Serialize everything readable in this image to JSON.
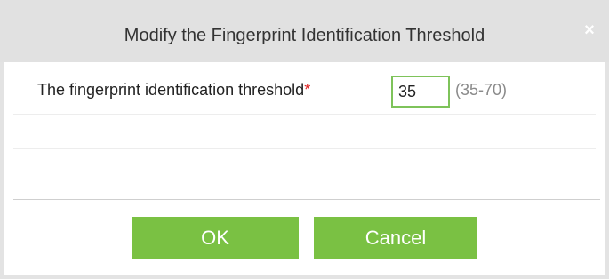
{
  "dialog": {
    "title": "Modify the Fingerprint Identification Threshold",
    "close_icon": "×"
  },
  "form": {
    "threshold_label": "The fingerprint identification threshold",
    "required_marker": "*",
    "threshold_value": "35",
    "range_hint": "(35-70)"
  },
  "buttons": {
    "ok_label": "OK",
    "cancel_label": "Cancel"
  },
  "colors": {
    "titlebar": "#e1e1e1",
    "button_green": "#7ac143",
    "input_border": "#7ec35a",
    "required": "#e02020"
  }
}
